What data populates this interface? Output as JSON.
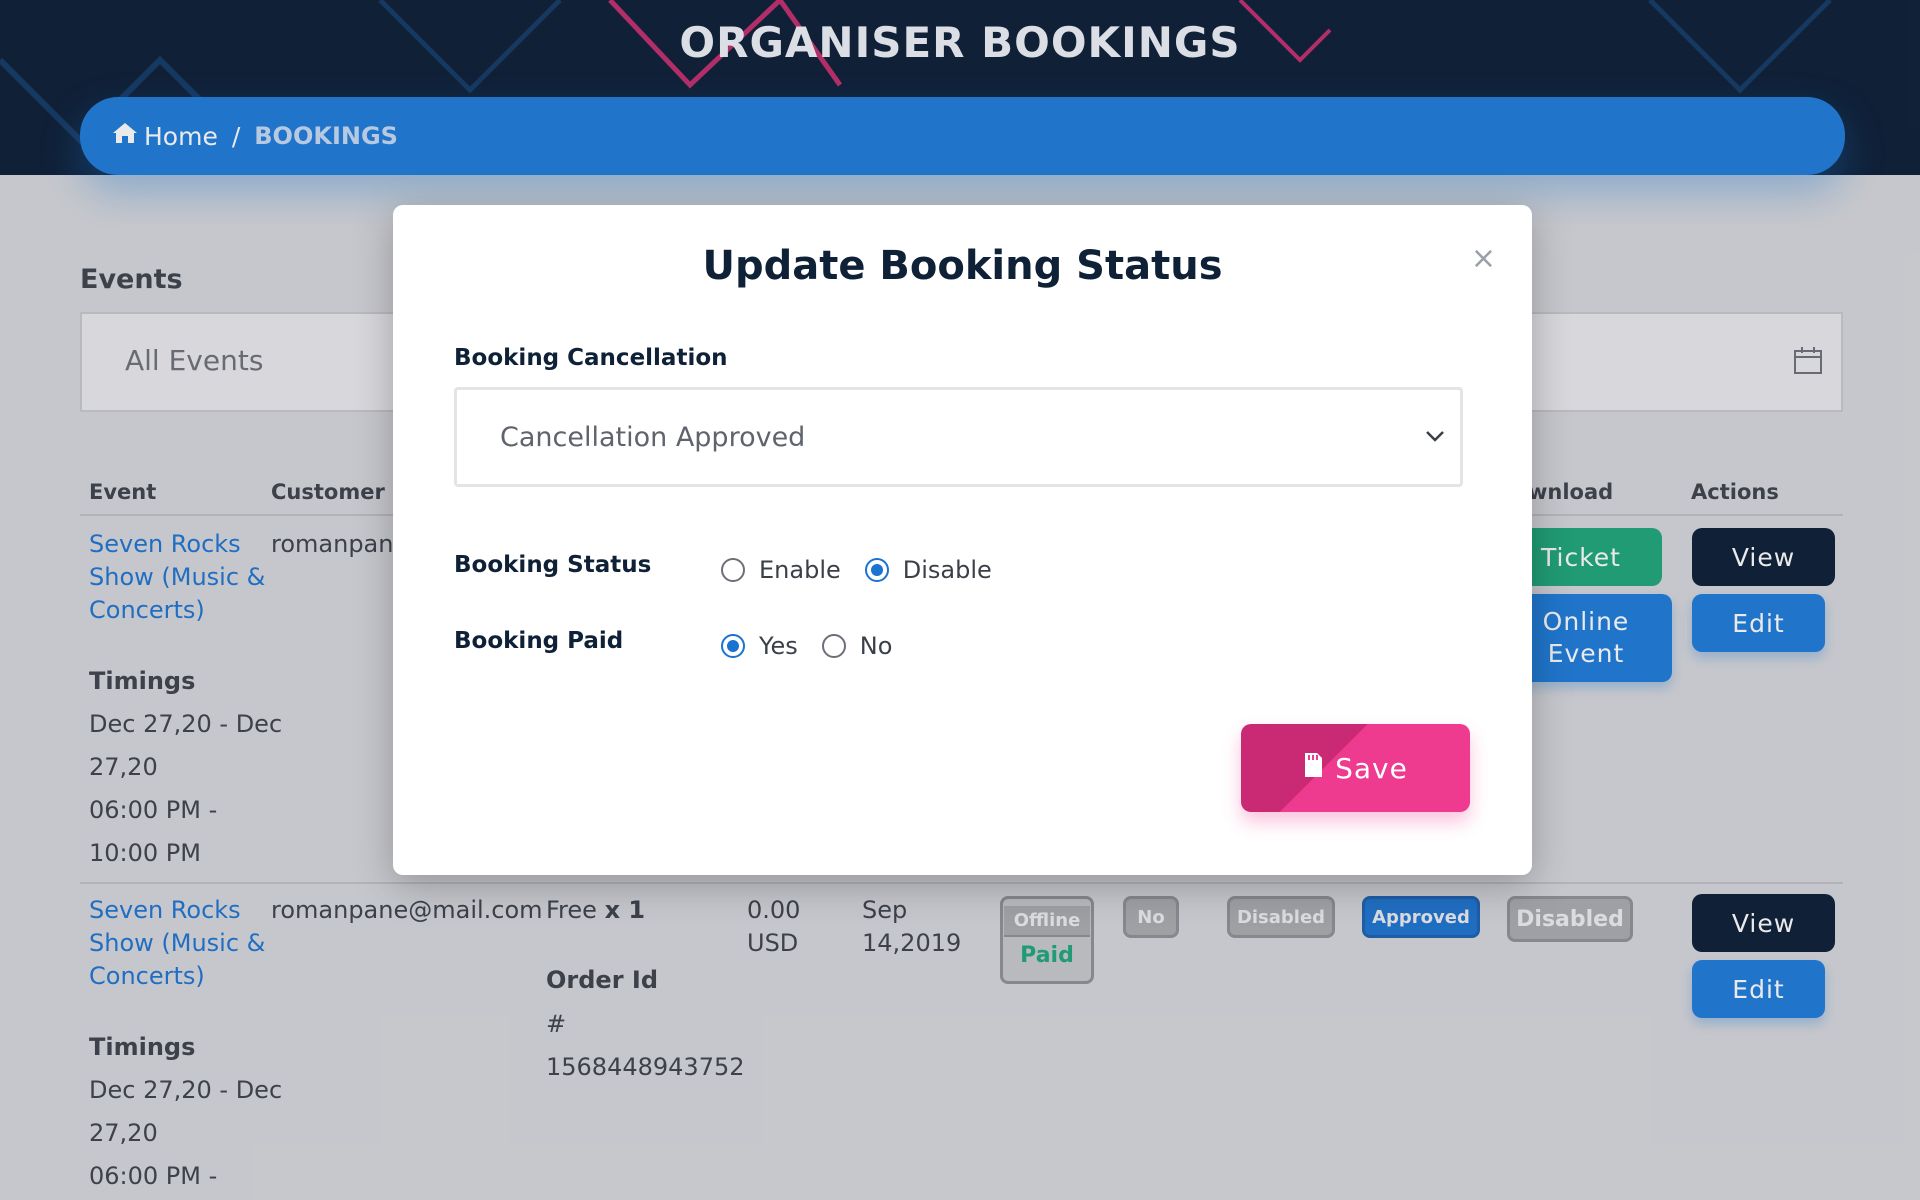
{
  "header": {
    "title": "ORGANISER BOOKINGS"
  },
  "breadcrumb": {
    "home_label": "Home",
    "separator": "/",
    "current": "BOOKINGS"
  },
  "filters": {
    "events_label": "Events",
    "events_value": "All Events"
  },
  "table": {
    "headers": {
      "event": "Event",
      "customer": "Customer Er",
      "download": "wnload",
      "actions": "Actions"
    },
    "rows": [
      {
        "event_name_1": "Seven Rocks",
        "event_name_2": "Show (Music &",
        "event_name_3": "Concerts)",
        "customer_email": "romanpane",
        "timings_label": "Timings",
        "timing_1": "Dec 27,20 - Dec",
        "timing_2": "27,20",
        "timing_3": "06:00 PM -",
        "timing_4": "10:00 PM",
        "ticket_button": "Ticket",
        "online_event_1": "Online",
        "online_event_2": "Event",
        "view_button": "View",
        "edit_button": "Edit"
      },
      {
        "event_name_1": "Seven Rocks",
        "event_name_2": "Show (Music &",
        "event_name_3": "Concerts)",
        "customer_email": "romanpane@mail.com",
        "ticket_type": "Free",
        "ticket_qty": "x 1",
        "order_label": "Order Id",
        "order_hash": "#",
        "order_id": "1568448943752",
        "amount_1": "0.00",
        "amount_2": "USD",
        "date_1": "Sep",
        "date_2": "14,2019",
        "payment_badge_top": "Offline",
        "payment_badge_bottom": "Paid",
        "checked_in_badge": "No",
        "status_badge": "Disabled",
        "cancellation_badge": "Approved",
        "download_badge": "Disabled",
        "timings_label": "Timings",
        "timing_1": "Dec 27,20 - Dec",
        "timing_2": "27,20",
        "timing_3": "06:00 PM -",
        "view_button": "View",
        "edit_button": "Edit"
      }
    ]
  },
  "modal": {
    "title": "Update Booking Status",
    "close_symbol": "×",
    "cancellation_label": "Booking Cancellation",
    "cancellation_value": "Cancellation Approved",
    "status_label": "Booking Status",
    "status_options": [
      "Enable",
      "Disable"
    ],
    "status_selected": "Disable",
    "paid_label": "Booking Paid",
    "paid_options": [
      "Yes",
      "No"
    ],
    "paid_selected": "Yes",
    "save_label": "Save"
  },
  "colors": {
    "header_bg": "#071a33",
    "breadcrumb_bg": "#1a7adb",
    "save_pink": "#ee3a8f",
    "radio_blue": "#1a72d1",
    "ticket_green": "#1aa578",
    "paid_green": "#1aa578"
  },
  "icons": {
    "home": "home-icon",
    "calendar": "calendar-icon",
    "chevron": "chevron-down-icon",
    "save": "floppy-disk-icon"
  }
}
